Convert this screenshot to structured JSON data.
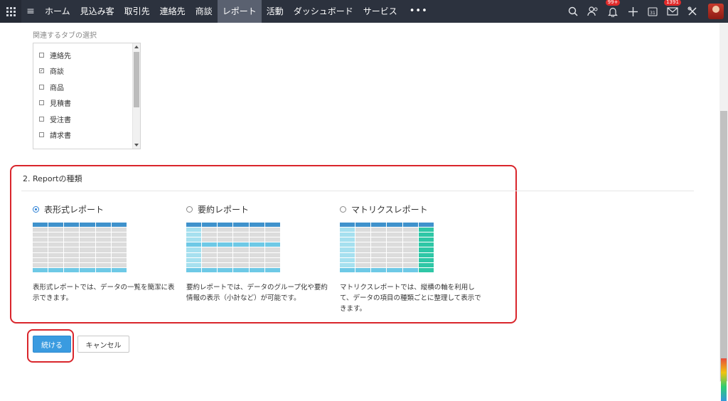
{
  "topnav": {
    "items": [
      "ホーム",
      "見込み客",
      "取引先",
      "連絡先",
      "商談",
      "レポート",
      "活動",
      "ダッシュボード",
      "サービス"
    ],
    "active": "レポート",
    "more": "•••",
    "notifications_badge": "99+",
    "mail_badge": "1391",
    "calendar_day": "31"
  },
  "tabs_section": {
    "title": "関連するタブの選択",
    "items": [
      {
        "label": "連絡先",
        "checked": false
      },
      {
        "label": "商談",
        "checked": true
      },
      {
        "label": "商品",
        "checked": false
      },
      {
        "label": "見積書",
        "checked": false
      },
      {
        "label": "受注書",
        "checked": false
      },
      {
        "label": "請求書",
        "checked": false
      }
    ]
  },
  "report_type": {
    "title": "2.  Reportの種類",
    "options": [
      {
        "label": "表形式レポート",
        "selected": true,
        "description": "表形式レポートでは、データの一覧を簡潔に表示できます。"
      },
      {
        "label": "要約レポート",
        "selected": false,
        "description": "要約レポートでは、データのグループ化や要約情報の表示（小計など）が可能です。"
      },
      {
        "label": "マトリクスレポート",
        "selected": false,
        "description": "マトリクスレポートでは、縦横の軸を利用して、データの項目の種類ごとに整理して表示できます。"
      }
    ]
  },
  "actions": {
    "continue": "続ける",
    "cancel": "キャンセル"
  },
  "colors": {
    "nav_bg": "#2c323e",
    "accent": "#3a9be0",
    "highlight": "#d9262c"
  }
}
